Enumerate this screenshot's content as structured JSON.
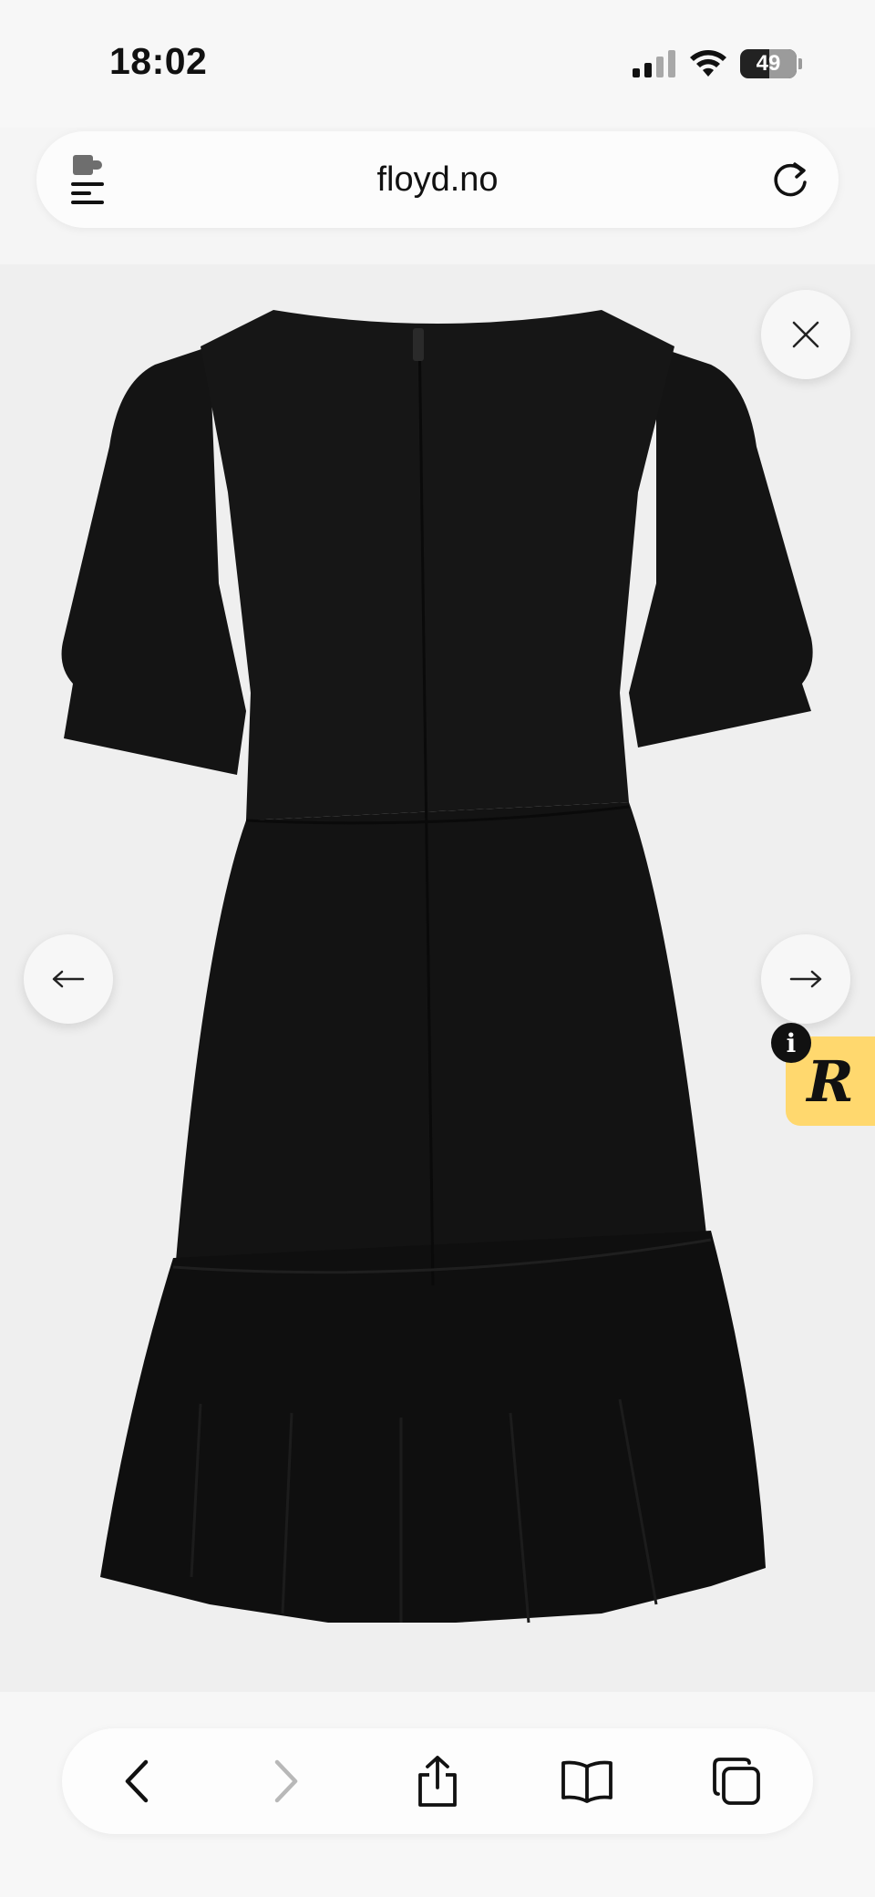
{
  "status_bar": {
    "time": "18:02",
    "battery": "49"
  },
  "address_bar": {
    "url": "floyd.no"
  },
  "product_viewer": {
    "image_alt": "Black dress back view",
    "icons": {
      "close": "close-icon",
      "prev": "arrow-left-icon",
      "next": "arrow-right-icon"
    }
  },
  "badge": {
    "letter": "R",
    "info": "i"
  },
  "toolbar": {
    "buttons": [
      "back-icon",
      "forward-icon",
      "share-icon",
      "bookmarks-icon",
      "tabs-icon"
    ],
    "forward_disabled": true
  }
}
